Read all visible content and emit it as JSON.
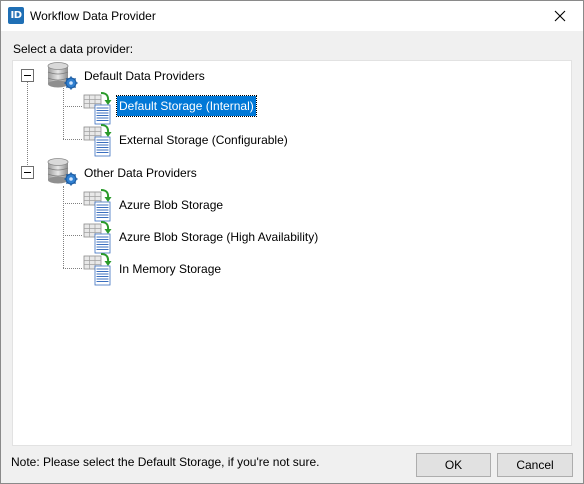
{
  "window": {
    "title": "Workflow Data Provider",
    "app_icon_text": "ID"
  },
  "prompt": "Select a data provider:",
  "tree": {
    "groups": [
      {
        "label": "Default Data Providers",
        "expanded": true,
        "icon": "database-gear-icon",
        "children": [
          {
            "label": "Default Storage (Internal)",
            "selected": true,
            "icon": "storage-table-icon"
          },
          {
            "label": "External Storage (Configurable)",
            "selected": false,
            "icon": "storage-table-icon"
          }
        ]
      },
      {
        "label": "Other Data Providers",
        "expanded": true,
        "icon": "database-gear-icon",
        "children": [
          {
            "label": "Azure Blob Storage",
            "selected": false,
            "icon": "storage-table-icon"
          },
          {
            "label": "Azure Blob Storage (High Availability)",
            "selected": false,
            "icon": "storage-table-icon"
          },
          {
            "label": "In Memory Storage",
            "selected": false,
            "icon": "storage-table-icon"
          }
        ]
      }
    ]
  },
  "footer": {
    "note": "Note: Please select the Default Storage, if you're not sure.",
    "ok_label": "OK",
    "cancel_label": "Cancel"
  },
  "colors": {
    "selection": "#0078d7",
    "app_icon": "#1f6fb5"
  }
}
